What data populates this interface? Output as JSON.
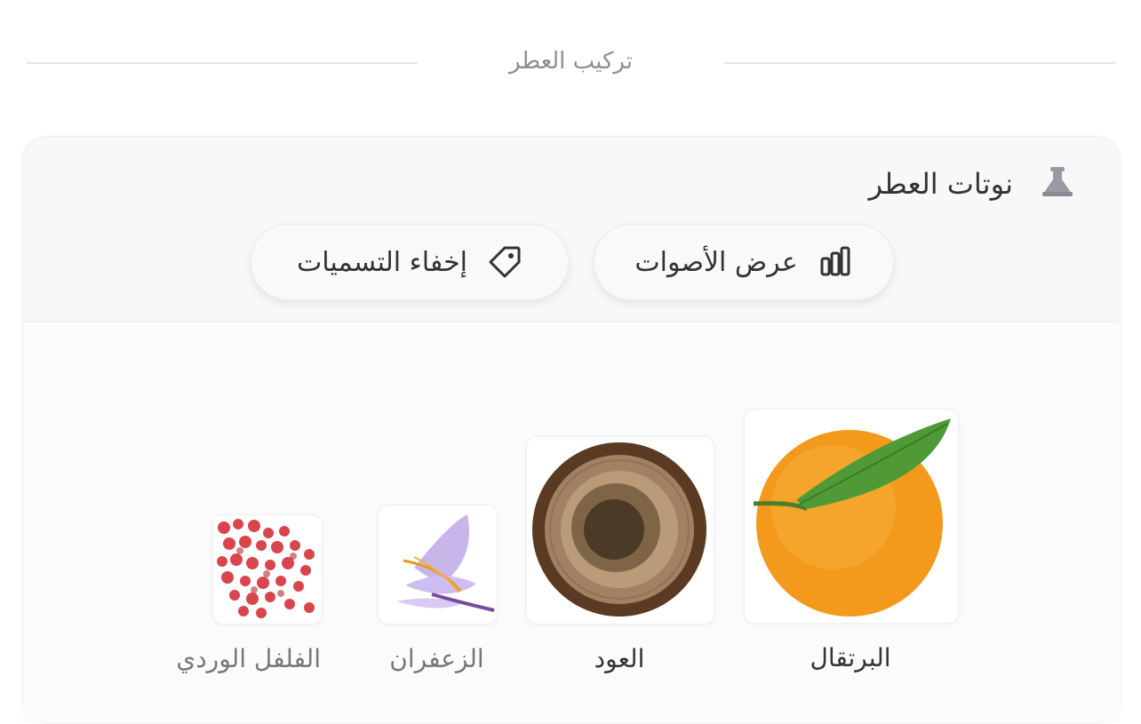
{
  "section": {
    "title": "تركيب العطر"
  },
  "card": {
    "title": "نوتات العطر",
    "buttons": {
      "votes_label": "عرض الأصوات",
      "labels_label": "إخفاء التسميات"
    }
  },
  "notes": [
    {
      "name": "البرتقال",
      "icon": "orange-image"
    },
    {
      "name": "العود",
      "icon": "oud-wood-image"
    },
    {
      "name": "الزعفران",
      "icon": "saffron-image"
    },
    {
      "name": "الفلفل الوردي",
      "icon": "pink-pepper-image"
    }
  ]
}
